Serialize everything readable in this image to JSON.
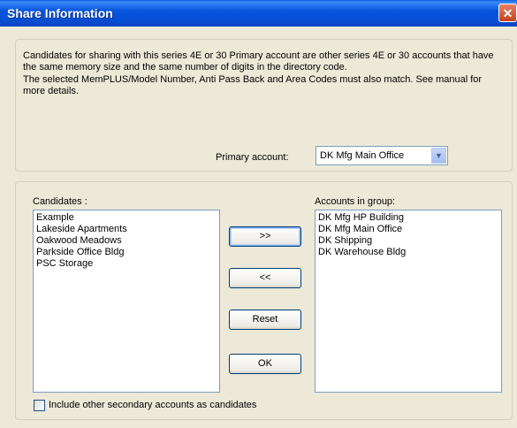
{
  "window": {
    "title": "Share Information",
    "close_glyph": "✕"
  },
  "description": {
    "p1": "Candidates for sharing with this series 4E or 30 Primary account are other series 4E or 30 accounts that have the same memory size and the same number of digits in the directory code.",
    "p2": "The selected MemPLUS/Model Number, Anti Pass Back and Area Codes must also match.  See manual for more details."
  },
  "primary": {
    "label": "Primary account:",
    "selected": "DK Mfg Main Office"
  },
  "candidates": {
    "label": "Candidates :",
    "items": [
      "Example",
      "Lakeside Apartments",
      "Oakwood Meadows",
      "Parkside Office Bldg",
      "PSC Storage"
    ]
  },
  "group": {
    "label": "Accounts in group:",
    "items": [
      "DK Mfg HP Building",
      "DK Mfg Main Office",
      "DK Shipping",
      "DK Warehouse Bldg"
    ]
  },
  "buttons": {
    "add": ">>",
    "remove": "<<",
    "reset": "Reset",
    "ok": "OK"
  },
  "checkbox": {
    "label": "Include other secondary accounts as candidates",
    "checked": false
  }
}
